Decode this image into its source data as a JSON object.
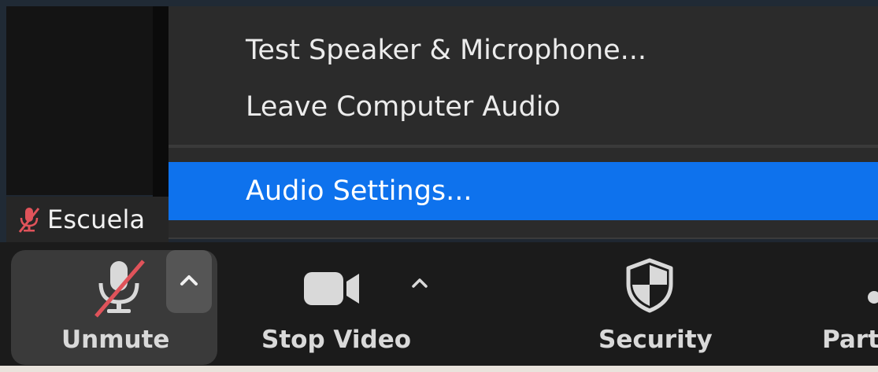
{
  "participant": {
    "name": "Escuela"
  },
  "audio_menu": {
    "items": [
      {
        "label": "Test Speaker & Microphone..."
      },
      {
        "label": "Leave Computer Audio"
      },
      {
        "label": "Audio Settings..."
      }
    ],
    "highlighted_index": 2
  },
  "toolbar": {
    "unmute_label": "Unmute",
    "stop_video_label": "Stop Video",
    "security_label": "Security",
    "participants_label": "Participants"
  },
  "icons": {
    "muted_mic": "microphone-slash-icon",
    "audio_options": "chevron-up-icon",
    "video": "video-camera-icon",
    "video_options": "chevron-up-icon",
    "security": "shield-icon"
  },
  "colors": {
    "menu_highlight": "#0e72ed",
    "mute_slash": "#e0535a",
    "toolbar_bg": "#1b1b1b",
    "menu_bg": "#2b2b2b"
  }
}
